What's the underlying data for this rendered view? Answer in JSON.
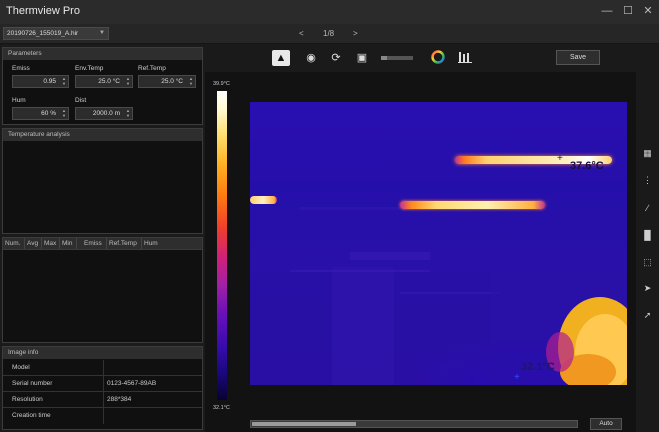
{
  "window": {
    "title": "Thermview Pro",
    "minimize_icon": "minimize-icon",
    "maximize_icon": "maximize-icon",
    "close_icon": "close-icon"
  },
  "filebar": {
    "file_name": "20190726_155019_A.hir",
    "page": "1/8",
    "prev_icon": "chevron-left-icon",
    "next_icon": "chevron-right-icon"
  },
  "parameters": {
    "title": "Parameters",
    "emiss_label": "Emiss",
    "emiss_value": "0.95",
    "env_temp_label": "Env.Temp",
    "env_temp_value": "25.0 °C",
    "ref_temp_label": "Ref.Temp",
    "ref_temp_value": "25.0 °C",
    "hum_label": "Hum",
    "hum_value": "60 %",
    "dist_label": "Dist",
    "dist_value": "2000.0 m"
  },
  "temperature_analysis": {
    "title": "Temperature analysis"
  },
  "measure_table": {
    "columns": [
      "Num.",
      "Avg",
      "Max",
      "Min",
      "Emiss",
      "Ref.Temp",
      "Hum"
    ]
  },
  "image_info": {
    "title": "Image info",
    "rows": [
      {
        "key": "Model",
        "value": ""
      },
      {
        "key": "Serial number",
        "value": "0123-4567-89AB"
      },
      {
        "key": "Resolution",
        "value": "288*384"
      },
      {
        "key": "Creation time",
        "value": ""
      }
    ]
  },
  "toolbar": {
    "save_label": "Save",
    "tools": [
      "palette-mountain-icon",
      "eye-icon",
      "rotate-icon",
      "crop-icon",
      "slider-icon",
      "color-wheel-icon",
      "histogram-icon"
    ]
  },
  "thermal_view": {
    "scale_max": "39.9°C",
    "scale_min": "32.1°C",
    "hot_label": "37.6°C",
    "cold_label": "32.1°C",
    "auto_label": "Auto"
  },
  "right_toolbar": {
    "tools": [
      "grid-icon",
      "point-icon",
      "line-icon",
      "bar-chart-icon",
      "area-select-icon",
      "cursor-icon",
      "send-icon"
    ]
  },
  "colors": {
    "background": "#1e1e1e",
    "panel": "#101010",
    "thermal_bg": "#2a10b4"
  }
}
